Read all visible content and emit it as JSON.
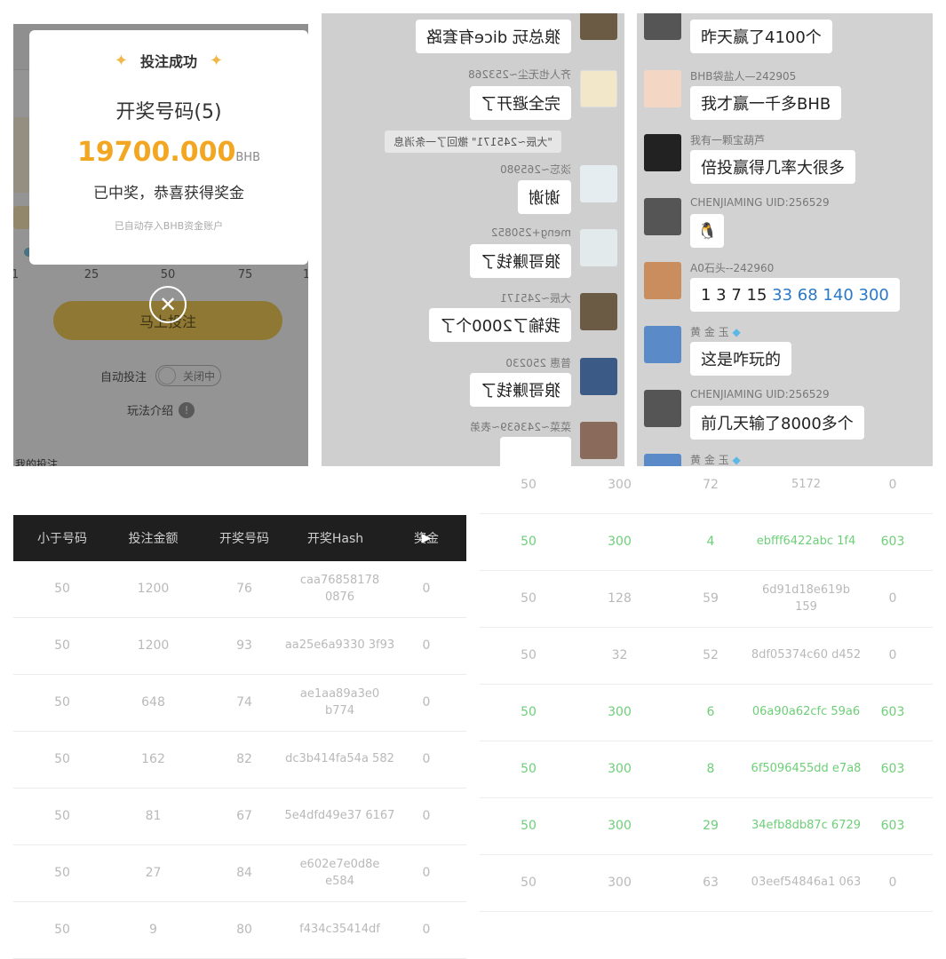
{
  "bet_panel": {
    "modal": {
      "title": "投注成功",
      "number_label": "开奖号码(5)",
      "amount": "19700.000",
      "unit": "BHB",
      "win_text": "已中奖，恭喜获得奖金",
      "note": "已自动存入BHB资金账户"
    },
    "ticks": [
      "1",
      "25",
      "50",
      "75",
      "1"
    ],
    "bet_button": "马上投注",
    "auto_bet_label": "自动投注",
    "auto_bet_state": "关闭中",
    "rules_label": "玩法介绍",
    "rules_icon": "!",
    "my_bets_label": "我的投注",
    "slider_level": 0.06
  },
  "chat_mirrored": {
    "messages": [
      {
        "sender": "",
        "text": "狼总玩 dice有套路"
      },
      {
        "sender": "齐人也无尘~253268",
        "text": "完全避开了"
      },
      {
        "recall": "\"大辰~245171\" 撤回了一条消息"
      },
      {
        "sender": "淡忘~265980",
        "text": "谢谢"
      },
      {
        "sender": "meng+250852",
        "text": "狼哥赚钱了"
      },
      {
        "sender": "大辰~245171",
        "text": "我输了2000个了"
      },
      {
        "sender": "普惠 250230",
        "text": "狼哥赚钱了"
      },
      {
        "sender": "菜菜~243639~表弟",
        "text": ""
      }
    ]
  },
  "chat_normal": {
    "messages": [
      {
        "sender": "",
        "text": "昨天赢了4100个"
      },
      {
        "sender": "BHB袋盐人—242905",
        "text": "我才赢一千多BHB"
      },
      {
        "sender": "我有一颗宝葫芦",
        "text": "倍投赢得几率大很多"
      },
      {
        "sender": "CHENJIAMING UID:256529",
        "text": ""
      },
      {
        "sender": "A0石头--242960",
        "text_plain": "1 3 7 15 ",
        "text_link": "33 68 140 300"
      },
      {
        "sender": "黄 金 玉",
        "text": "这是咋玩的"
      },
      {
        "sender": "CHENJIAMING UID:256529",
        "text": "前几天输了8000多个"
      },
      {
        "sender": "黄 金 玉",
        "text": ""
      }
    ]
  },
  "table_left": {
    "headers": [
      "小于号码",
      "投注金额",
      "开奖号码",
      "开奖Hash",
      "奖金"
    ],
    "rows": [
      {
        "under": "50",
        "amount": "1200",
        "number": "76",
        "hash": "caa76858178 0876",
        "prize": "0"
      },
      {
        "under": "50",
        "amount": "1200",
        "number": "93",
        "hash": "aa25e6a9330 3f93",
        "prize": "0"
      },
      {
        "under": "50",
        "amount": "648",
        "number": "74",
        "hash": "ae1aa89a3e0 b774",
        "prize": "0"
      },
      {
        "under": "50",
        "amount": "162",
        "number": "82",
        "hash": "dc3b414fa54a 582",
        "prize": "0"
      },
      {
        "under": "50",
        "amount": "81",
        "number": "67",
        "hash": "5e4dfd49e37 6167",
        "prize": "0"
      },
      {
        "under": "50",
        "amount": "27",
        "number": "84",
        "hash": "e602e7e0d8e e584",
        "prize": "0"
      },
      {
        "under": "50",
        "amount": "9",
        "number": "80",
        "hash": "f434c35414df",
        "prize": "0"
      }
    ]
  },
  "table_right": {
    "rows": [
      {
        "under": "50",
        "amount": "300",
        "number": "72",
        "hash": "5172",
        "prize": "0",
        "win": false
      },
      {
        "under": "50",
        "amount": "300",
        "number": "4",
        "hash": "ebfff6422abc 1f4",
        "prize": "603",
        "win": true
      },
      {
        "under": "50",
        "amount": "128",
        "number": "59",
        "hash": "6d91d18e619b 159",
        "prize": "0",
        "win": false
      },
      {
        "under": "50",
        "amount": "32",
        "number": "52",
        "hash": "8df05374c60 d452",
        "prize": "0",
        "win": false
      },
      {
        "under": "50",
        "amount": "300",
        "number": "6",
        "hash": "06a90a62cfc 59a6",
        "prize": "603",
        "win": true
      },
      {
        "under": "50",
        "amount": "300",
        "number": "8",
        "hash": "6f5096455dd e7a8",
        "prize": "603",
        "win": true
      },
      {
        "under": "50",
        "amount": "300",
        "number": "29",
        "hash": "34efb8db87c 6729",
        "prize": "603",
        "win": true
      },
      {
        "under": "50",
        "amount": "300",
        "number": "63",
        "hash": "03eef54846a1 063",
        "prize": "0",
        "win": false
      }
    ]
  },
  "colors": {
    "accent_gold": "#f2a622",
    "button_yellow": "#f6cf5b",
    "win_green": "#6dcf78",
    "table_header": "#1f1f1f"
  }
}
